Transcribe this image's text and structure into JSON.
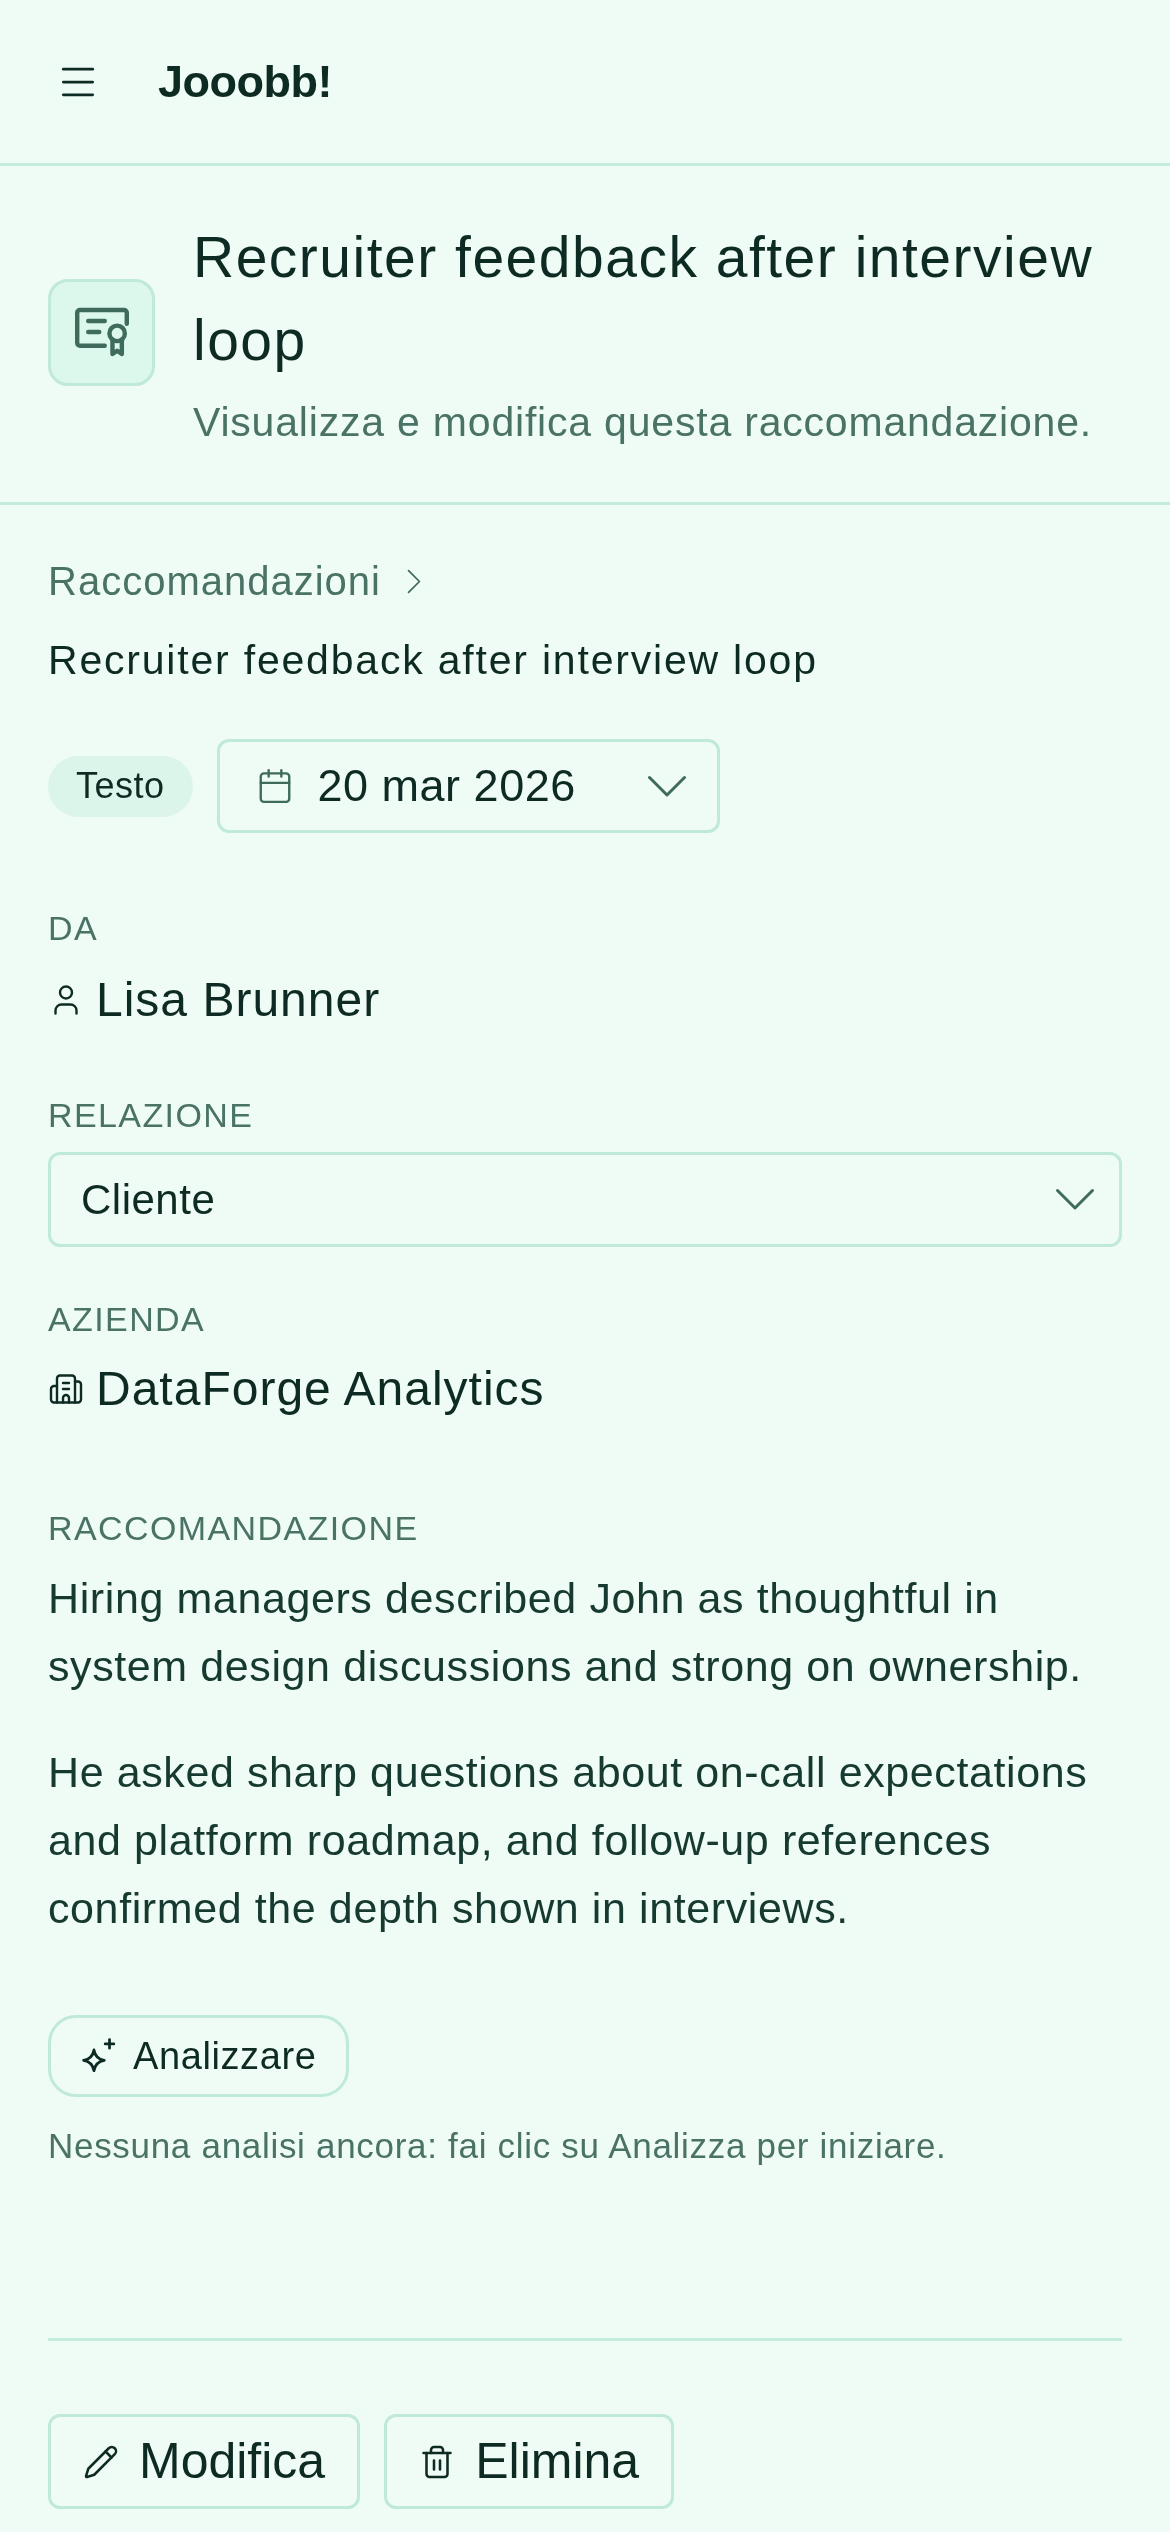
{
  "app_bar": {
    "brand": "Jooobb!"
  },
  "page_header": {
    "title": "Recruiter feedback after interview loop",
    "subtitle": "Visualizza e modifica questa raccomandazione."
  },
  "breadcrumb": {
    "items": [
      {
        "label": "Raccomandazioni"
      }
    ],
    "current": "Recruiter feedback after interview loop"
  },
  "type_badge": "Testo",
  "date_select": {
    "value": "20 mar 2026"
  },
  "fields": [
    {
      "kind": "person",
      "label": "DA",
      "value": "Lisa Brunner"
    },
    {
      "kind": "select",
      "label": "RELAZIONE",
      "value": "Cliente"
    },
    {
      "kind": "company",
      "label": "AZIENDA",
      "value": "DataForge Analytics"
    }
  ],
  "recommendation": {
    "label": "RACCOMANDAZIONE",
    "paragraphs": [
      "Hiring managers described John as thoughtful in system design discussions and strong on ownership.",
      "He asked sharp questions about on-call expectations and platform roadmap, and follow-up references confirmed the depth shown in interviews."
    ]
  },
  "analyze_button": {
    "label": "Analizzare"
  },
  "analysis_note": "Nessuna analisi ancora: fai clic su Analizza per iniziare.",
  "actions": [
    {
      "kind": "edit",
      "label": "Modifica"
    },
    {
      "kind": "delete",
      "label": "Elimina"
    }
  ]
}
